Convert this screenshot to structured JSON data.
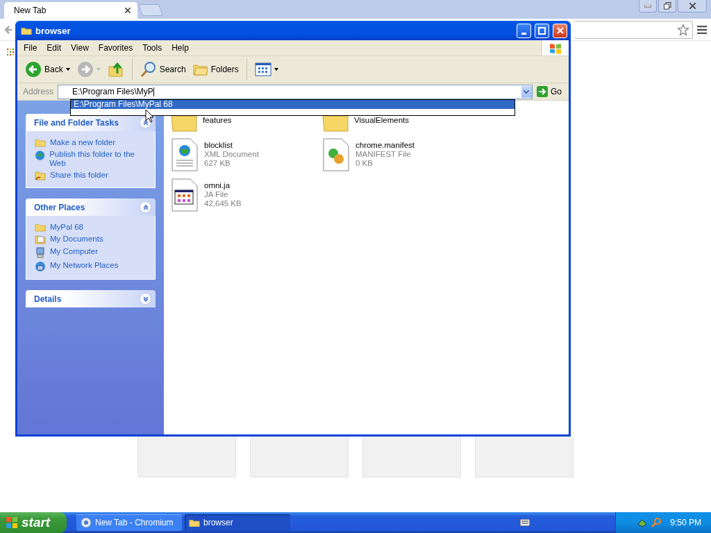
{
  "browser": {
    "tabs": [
      {
        "title": "New Tab",
        "selected": true
      }
    ]
  },
  "explorer": {
    "title": "browser",
    "menu": [
      "File",
      "Edit",
      "View",
      "Favorites",
      "Tools",
      "Help"
    ],
    "toolbar": [
      {
        "kind": "back",
        "label": "Back",
        "disabled": false
      },
      {
        "kind": "forward",
        "disabled": true
      },
      {
        "kind": "up"
      },
      {
        "kind": "search",
        "label": "Search"
      },
      {
        "kind": "folders",
        "label": "Folders"
      },
      {
        "kind": "views"
      }
    ],
    "address": {
      "label": "Address",
      "value": "E:\\Program Files\\MyP",
      "go": "Go"
    },
    "suggestions": [
      {
        "text": "E:\\Program Files\\MyPal 68",
        "selected": true
      }
    ],
    "panels": [
      {
        "title": "File and Folder Tasks",
        "expanded": true,
        "items": [
          {
            "kind": "newfolder",
            "label": "Make a new folder"
          },
          {
            "kind": "publish",
            "label": "Publish this folder to the Web"
          },
          {
            "kind": "share",
            "label": "Share this folder"
          }
        ]
      },
      {
        "title": "Other Places",
        "expanded": true,
        "items": [
          {
            "kind": "folder",
            "label": "MyPal 68"
          },
          {
            "kind": "documents",
            "label": "My Documents"
          },
          {
            "kind": "computer",
            "label": "My Computer"
          },
          {
            "kind": "network",
            "label": "My Network Places"
          }
        ]
      },
      {
        "title": "Details",
        "expanded": false
      }
    ],
    "files": [
      {
        "kind": "folder",
        "name": "features"
      },
      {
        "kind": "folder",
        "name": "VisualElements"
      },
      {
        "kind": "xml",
        "name": "blocklist",
        "type": "XML Document",
        "size": "627 KB"
      },
      {
        "kind": "manifest",
        "name": "chrome.manifest",
        "type": "MANIFEST File",
        "size": "0 KB"
      },
      {
        "kind": "app",
        "name": "omni.ja",
        "type": "JA File",
        "size": "42,645 KB"
      }
    ]
  },
  "taskbar": {
    "start": "start",
    "tasks": [
      {
        "kind": "chromium",
        "label": "New Tab - Chromium",
        "selected": false
      },
      {
        "kind": "folder",
        "label": "browser",
        "selected": true
      }
    ],
    "clock": "9:50 PM"
  }
}
